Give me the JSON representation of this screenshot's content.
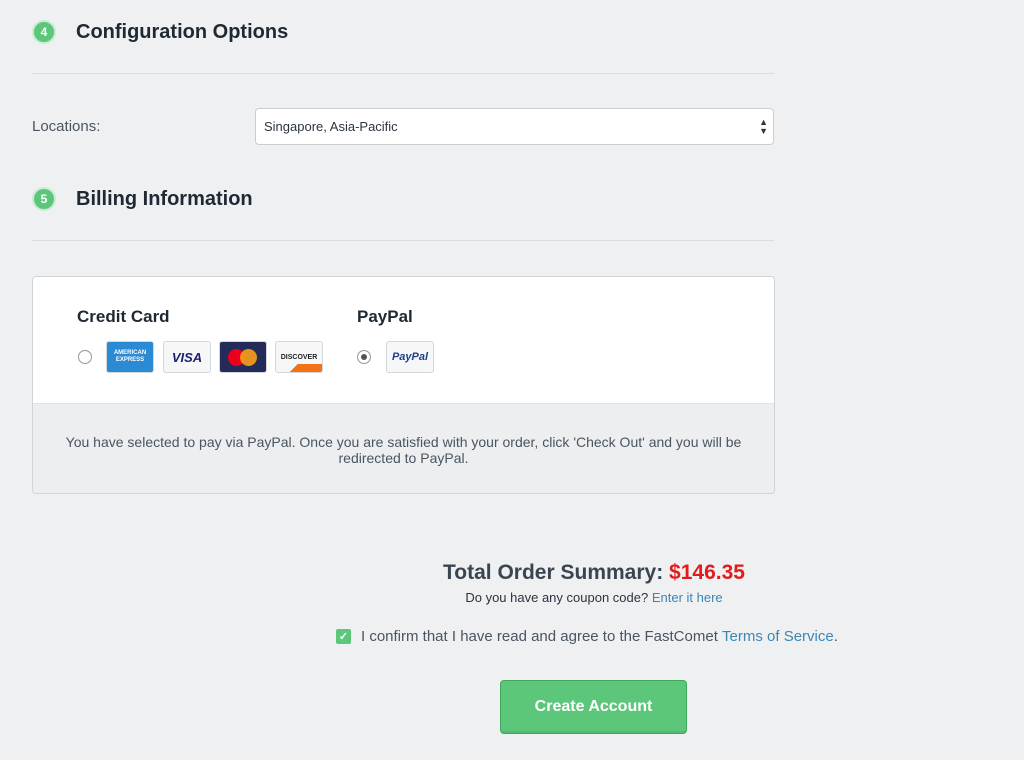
{
  "config": {
    "step_number": "4",
    "title": "Configuration Options",
    "locations_label": "Locations:",
    "locations_value": "Singapore, Asia-Pacific"
  },
  "billing": {
    "step_number": "5",
    "title": "Billing Information",
    "methods": [
      {
        "title": "Credit Card",
        "selected": false,
        "cards": [
          "AMERICAN EXPRESS",
          "VISA",
          "mastercard",
          "DISCOVER"
        ]
      },
      {
        "title": "PayPal",
        "selected": true,
        "cards": [
          "PayPal"
        ]
      }
    ],
    "notice": "You have selected to pay via PayPal. Once you are satisfied with your order, click 'Check Out' and you will be redirected to PayPal."
  },
  "summary": {
    "label": "Total Order Summary:",
    "amount": "$146.35",
    "coupon_text": "Do you have any coupon code?",
    "coupon_link": "Enter it here",
    "confirm_text": "I confirm that I have read and agree to the FastComet",
    "confirm_link": "Terms of Service",
    "confirm_end": ".",
    "confirmed": true,
    "button_label": "Create Account"
  },
  "colors": {
    "accent": "#5cc77a",
    "price": "#e21b1b",
    "link": "#3e86b4",
    "background": "#eef0f2"
  }
}
